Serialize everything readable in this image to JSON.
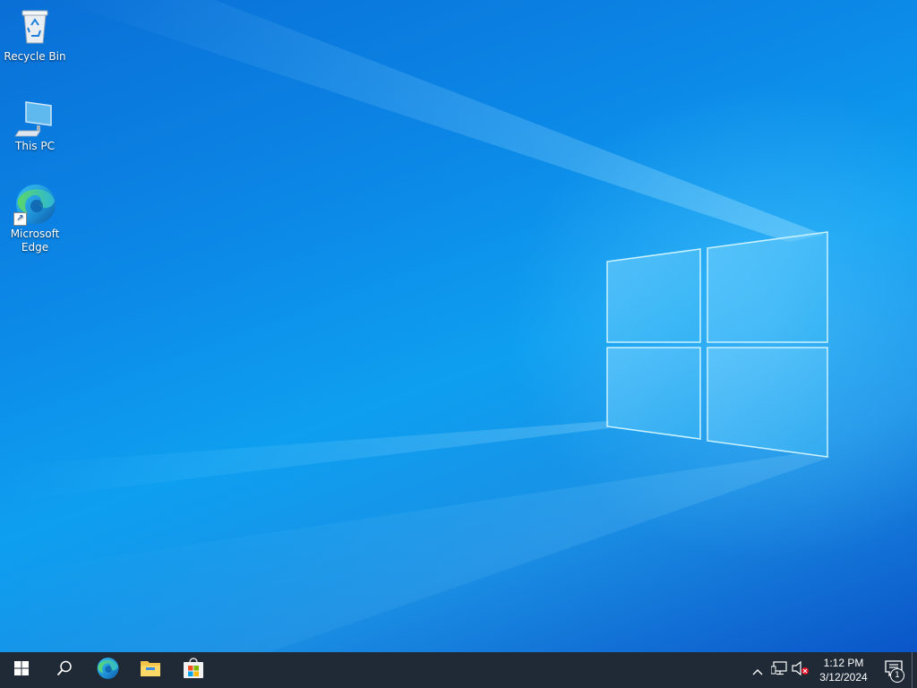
{
  "desktop": {
    "icons": [
      {
        "label": "Recycle Bin",
        "icon": "recycle-bin-icon"
      },
      {
        "label": "This PC",
        "icon": "computer-icon"
      },
      {
        "label": "Microsoft Edge",
        "icon": "edge-icon"
      }
    ]
  },
  "taskbar": {
    "start": "windows-start-icon",
    "search": "search-icon",
    "apps": [
      {
        "name": "Microsoft Edge",
        "icon": "edge-icon"
      },
      {
        "name": "File Explorer",
        "icon": "folder-icon"
      },
      {
        "name": "Microsoft Store",
        "icon": "store-icon"
      }
    ],
    "tray": {
      "chevron": "chevron-up-icon",
      "network": "network-icon",
      "volume": "volume-muted-icon"
    },
    "clock": {
      "time": "1:12 PM",
      "date": "3/12/2024"
    },
    "notifications": {
      "icon": "action-center-icon",
      "count": "1"
    }
  },
  "colors": {
    "taskbar": "#1f2a36",
    "desktop_accent": "#0b86e6"
  }
}
